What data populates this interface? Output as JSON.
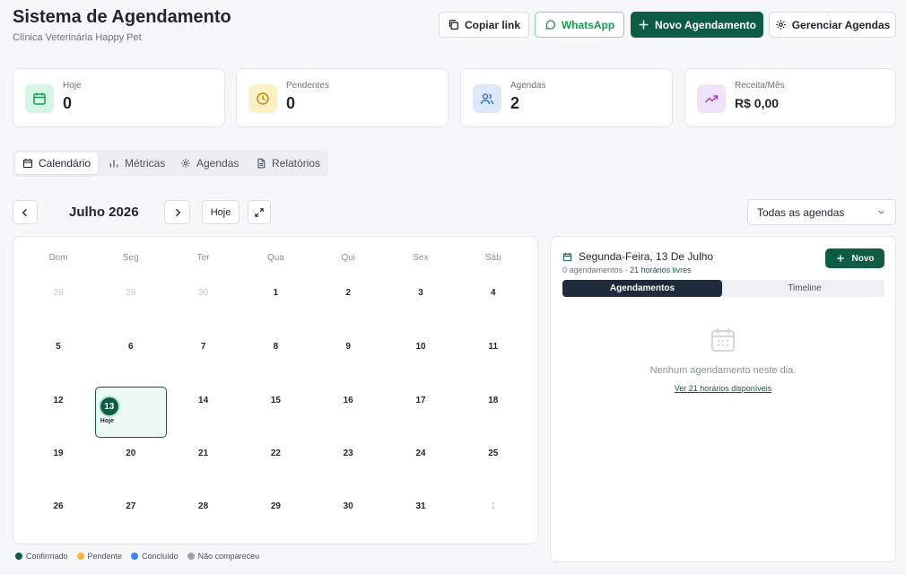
{
  "header": {
    "title": "Sistema de Agendamento",
    "subtitle": "Clínica Veterinária Happy Pet",
    "buttons": {
      "copy": "Copiar link",
      "whatsapp": "WhatsApp",
      "new": "Novo Agendamento",
      "manage": "Gerenciar Agendas"
    }
  },
  "stats": [
    {
      "label": "Hoje",
      "value": "0",
      "icon": "calendar-icon",
      "color": "#d7f5e4"
    },
    {
      "label": "Pendentes",
      "value": "0",
      "icon": "clock-icon",
      "color": "#fdf0c4"
    },
    {
      "label": "Agendas",
      "value": "2",
      "icon": "users-icon",
      "color": "#dde8fb"
    },
    {
      "label": "Receita/Mês",
      "value": "R$ 0,00",
      "icon": "trending-up-icon",
      "color": "#f1e2fb"
    }
  ],
  "tabs": [
    "Calendário",
    "Métricas",
    "Agendas",
    "Relatórios"
  ],
  "calendar": {
    "month": "Julho 2026",
    "today_button": "Hoje",
    "filter": "Todas as agendas",
    "weekdays": [
      "Dom",
      "Seg",
      "Ter",
      "Qua",
      "Qui",
      "Sex",
      "Sáb"
    ],
    "weeks": [
      [
        "28",
        "29",
        "30",
        "1",
        "2",
        "3",
        "4"
      ],
      [
        "5",
        "6",
        "7",
        "8",
        "9",
        "10",
        "11"
      ],
      [
        "12",
        "13",
        "14",
        "15",
        "16",
        "17",
        "18"
      ],
      [
        "19",
        "20",
        "21",
        "22",
        "23",
        "24",
        "25"
      ],
      [
        "26",
        "27",
        "28",
        "29",
        "30",
        "31",
        "1"
      ]
    ],
    "today_label": "Hoje"
  },
  "legend": [
    {
      "label": "Confirmado",
      "color": "#0f5c44"
    },
    {
      "label": "Pendente",
      "color": "#f5b82e"
    },
    {
      "label": "Concluído",
      "color": "#3b82f6"
    },
    {
      "label": "Não compareceu",
      "color": "#9aa1ab"
    }
  ],
  "day_panel": {
    "title": "Segunda-Feira, 13 De Julho",
    "count": "0 agendamentos",
    "free": "· 21 horários livres",
    "new_button": "Novo",
    "tabs": [
      "Agendamentos",
      "Timeline"
    ],
    "empty": "Nenhum agendamento neste dia.",
    "link": "Ver 21 horários disponíveis"
  },
  "colors": {
    "brand": "#0f5c44",
    "whatsapp": "#1a9a52"
  }
}
